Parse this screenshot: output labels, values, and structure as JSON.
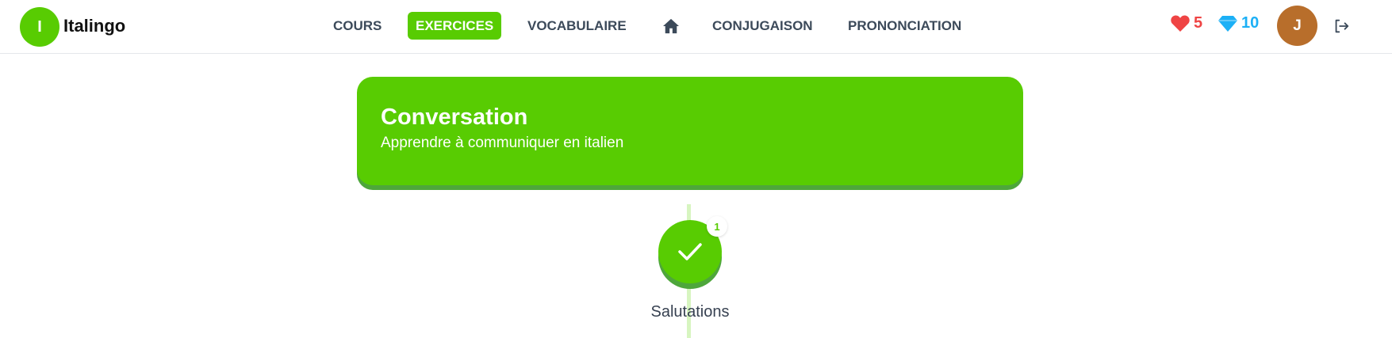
{
  "app": {
    "name": "Italingo",
    "logo_letter": "I"
  },
  "nav": {
    "items": [
      {
        "label": "COURS",
        "active": false
      },
      {
        "label": "EXERCICES",
        "active": true
      },
      {
        "label": "VOCABULAIRE",
        "active": false
      },
      {
        "label": "CONJUGAISON",
        "active": false
      },
      {
        "label": "PRONONCIATION",
        "active": false
      }
    ],
    "home_icon": "home-icon"
  },
  "stats": {
    "hearts": "5",
    "gems": "10",
    "heart_color": "#ef4444",
    "gem_color": "#1cb0f6"
  },
  "user": {
    "avatar_letter": "J",
    "avatar_color": "#b86e2b"
  },
  "banner": {
    "title": "Conversation",
    "subtitle": "Apprendre à communiquer en italien",
    "color": "#58cc02"
  },
  "lesson": {
    "label": "Salutations",
    "badge": "1",
    "status_icon": "check-icon"
  }
}
